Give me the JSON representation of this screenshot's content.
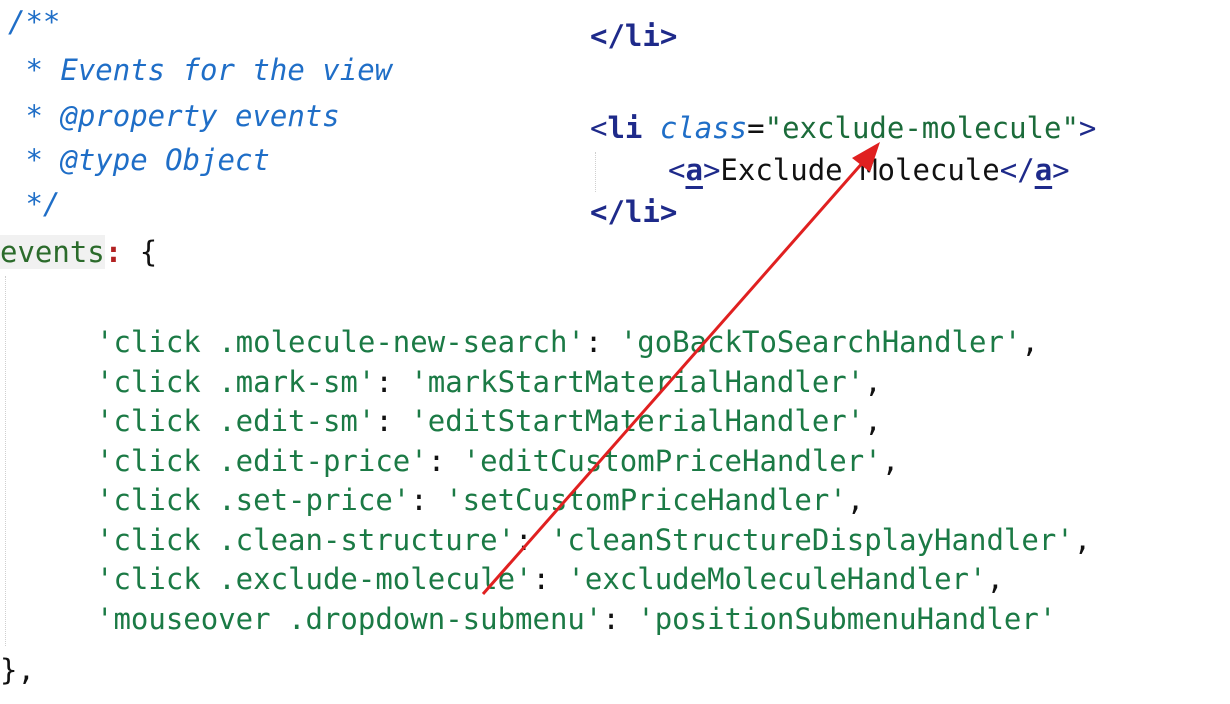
{
  "doc_comment": {
    "open": "/**",
    "line1": " * Events for the view",
    "line2": " * @property events",
    "line3": " * @type Object",
    "close": " */"
  },
  "html_snippet": {
    "close_li_top": "</li>",
    "li_open_lt": "<",
    "li_tag": "li",
    "li_attr": "class",
    "li_eq": "=",
    "li_attr_value": "\"exclude-molecule\"",
    "li_open_gt": ">",
    "a_open_lt": "<",
    "a_tag": "a",
    "a_open_gt": ">",
    "a_text": "Exclude Molecule",
    "a_close_lt": "</",
    "a_close_tag": "a",
    "a_close_gt": ">",
    "close_li_bottom": "</li>"
  },
  "events_block": {
    "prop_name": "events",
    "colon": ":",
    "open_brace": " {",
    "close_brace": "},",
    "entries": [
      {
        "key": "'click .molecule-new-search'",
        "value": "'goBackToSearchHandler'",
        "sep": ","
      },
      {
        "key": "'click .mark-sm'",
        "value": "'markStartMaterialHandler'",
        "sep": ","
      },
      {
        "key": "'click .edit-sm'",
        "value": "'editStartMaterialHandler'",
        "sep": ","
      },
      {
        "key": "'click .edit-price'",
        "value": "'editCustomPriceHandler'",
        "sep": ","
      },
      {
        "key": "'click .set-price'",
        "value": "'setCustomPriceHandler'",
        "sep": ","
      },
      {
        "key": "'click .clean-structure'",
        "value": "'cleanStructureDisplayHandler'",
        "sep": ","
      },
      {
        "key": "'click .exclude-molecule'",
        "value": "'excludeMoleculeHandler'",
        "sep": ","
      },
      {
        "key": "'mouseover .dropdown-submenu'",
        "value": "'positionSubmenuHandler'",
        "sep": ""
      }
    ]
  },
  "colors": {
    "arrow": "#e02020",
    "comment": "#1f6ec7",
    "string": "#1b7a45",
    "tag": "#1e2a8a"
  }
}
